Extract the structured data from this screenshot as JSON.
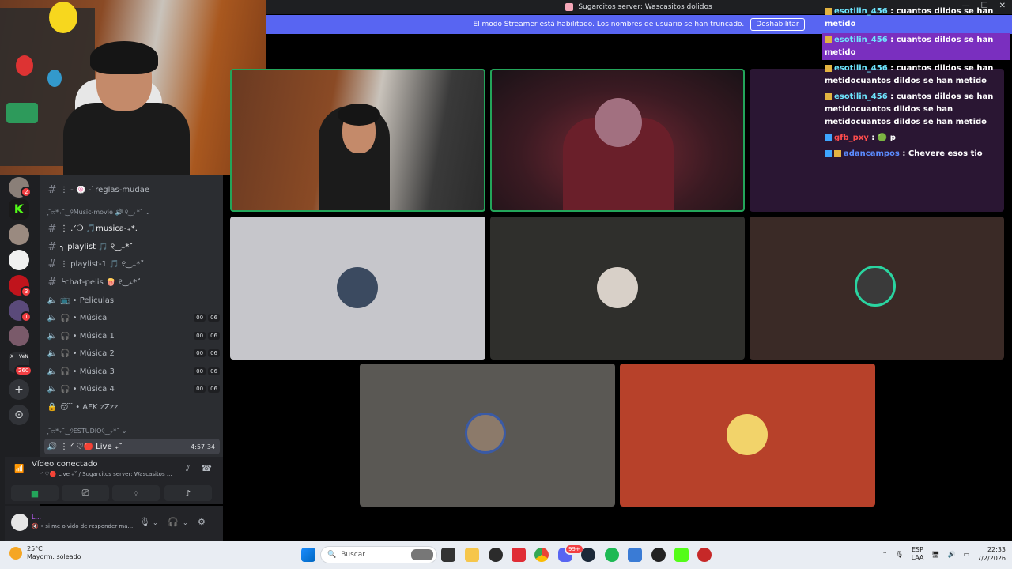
{
  "window": {
    "title": "Sugarcitos server: Wascasitos dolidos"
  },
  "streamer_banner": {
    "text": "El modo Streamer está habilitado. Los nombres de usuario se han truncado.",
    "button": "Deshabilitar"
  },
  "server_rail": {
    "badges": [
      "2",
      "3",
      "1",
      "260"
    ],
    "labels": [
      "X",
      "VeN"
    ]
  },
  "channels": {
    "top_channel": "⋮ - 🍥 -ˋreglas-mudae",
    "category_music": "·̩͙˚ෆ*₊˚‿୨Music-movie 🔊 ୧‿₊*˚ ⌄",
    "items": [
      {
        "type": "text",
        "label": "⋮ .ᐟ❍ 🎵musica-₊*.",
        "bright": true
      },
      {
        "type": "text",
        "label": "╮ playlist 🎵 ୧‿₊*˚",
        "bright": true
      },
      {
        "type": "text",
        "label": "⋮ playlist-1 🎵 ୧‿₊*˚",
        "bright": false
      },
      {
        "type": "text",
        "label": "╰chat-pelis 🍿 ୧‿₊*˚",
        "bright": false
      },
      {
        "type": "voice",
        "label": "📺 • Peliculas"
      },
      {
        "type": "voice",
        "label": "🎧 • Música",
        "c1": "00",
        "c2": "06"
      },
      {
        "type": "voice",
        "label": "🎧 • Música 1",
        "c1": "00",
        "c2": "06"
      },
      {
        "type": "voice",
        "label": "🎧 • Música 2",
        "c1": "00",
        "c2": "06"
      },
      {
        "type": "voice",
        "label": "🎧 • Música 3",
        "c1": "00",
        "c2": "06"
      },
      {
        "type": "voice",
        "label": "🎧 • Música 4",
        "c1": "00",
        "c2": "06"
      },
      {
        "type": "lock",
        "label": "😴 • AFK zZzz"
      }
    ],
    "category_study": "·̩͙˚ෆ*₊˚‿୨ESTUDIO୧‿₊*˚ ⌄",
    "live_channel": {
      "label": "⋮ ᐟ ♡🔴 Live ₊˚",
      "time": "4:57:34"
    }
  },
  "voice_panel": {
    "status": "Vídeo conectado",
    "subtitle": "⋮ ᐟ ♡🔴 Live ₊˚ / Sugarcitos server: Wascasitos ..."
  },
  "user_panel": {
    "name": "L...",
    "status": "🔇 • si me olvido de responder ma..."
  },
  "chat": [
    {
      "user": "esotilin_456",
      "text": " : cuantos dildos se han metido",
      "highlight": false,
      "color": "cyan"
    },
    {
      "user": "esotilin_456",
      "text": " : cuantos dildos se han metido",
      "highlight": true,
      "color": "cyan"
    },
    {
      "user": "esotilin_456",
      "text": " : cuantos dildos se han metidocuantos dildos se han metido",
      "highlight": false,
      "color": "cyan"
    },
    {
      "user": "esotilin_456",
      "text": " : cuantos dildos se han metidocuantos dildos se han metidocuantos dildos se han metido",
      "highlight": false,
      "color": "cyan"
    },
    {
      "user": "gfb_pxy",
      "text": " : 🟢 p",
      "highlight": false,
      "color": "red"
    },
    {
      "user": "adancampos",
      "text": " : Chevere esos tio",
      "highlight": false,
      "color": "blue"
    }
  ],
  "taskbar": {
    "weather_temp": "25°C",
    "weather_desc": "Mayorm. soleado",
    "search_placeholder": "Buscar",
    "lang_1": "ESP",
    "lang_2": "LAA",
    "time": "22:33",
    "date": "7/2/2026",
    "badge": "99+"
  }
}
